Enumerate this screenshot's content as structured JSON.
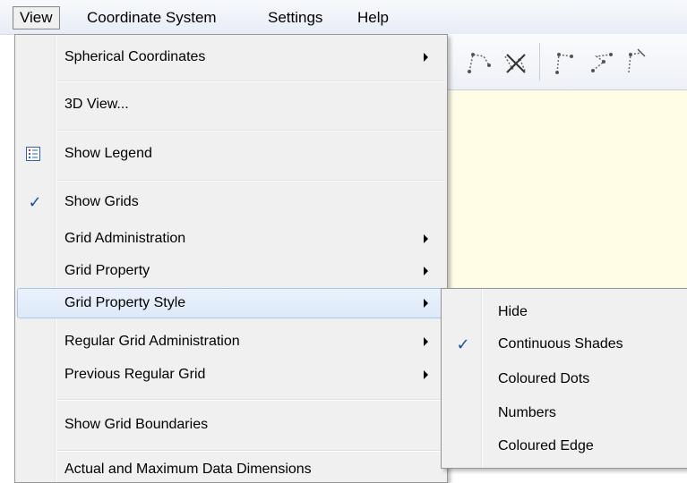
{
  "menubar": {
    "items": [
      "View",
      "Coordinate System",
      "Settings",
      "Help"
    ]
  },
  "view_menu": {
    "items": [
      {
        "label": "Spherical Coordinates",
        "submenu": true
      },
      {
        "label": "3D View..."
      },
      {
        "label": "Show Legend",
        "icon": "legend-icon"
      },
      {
        "label": "Show Grids",
        "checked": true
      },
      {
        "label": "Grid Administration",
        "submenu": true
      },
      {
        "label": "Grid Property",
        "submenu": true
      },
      {
        "label": "Grid Property Style",
        "submenu": true,
        "highlighted": true
      },
      {
        "label": "Regular Grid Administration",
        "submenu": true
      },
      {
        "label": "Previous Regular Grid",
        "submenu": true
      },
      {
        "label": "Show Grid Boundaries"
      },
      {
        "label": "Actual and Maximum Data Dimensions"
      }
    ]
  },
  "grid_property_style_submenu": {
    "items": [
      {
        "label": "Hide"
      },
      {
        "label": "Continuous Shades",
        "checked": true
      },
      {
        "label": "Coloured Dots"
      },
      {
        "label": "Numbers"
      },
      {
        "label": "Coloured Edge"
      }
    ]
  },
  "toolbar": {
    "icons": [
      "polyline-tool-icon",
      "delete-polyline-tool-icon",
      "polyline-points-tool-icon",
      "connect-points-tool-icon",
      "polyline-edit-tool-icon"
    ]
  },
  "glyphs": {
    "check": "✓"
  },
  "colors": {
    "highlight": "#dde9f8",
    "canvas": "#fffde6",
    "menu_bg": "#f0f0f0",
    "check": "#1a4fa8"
  }
}
